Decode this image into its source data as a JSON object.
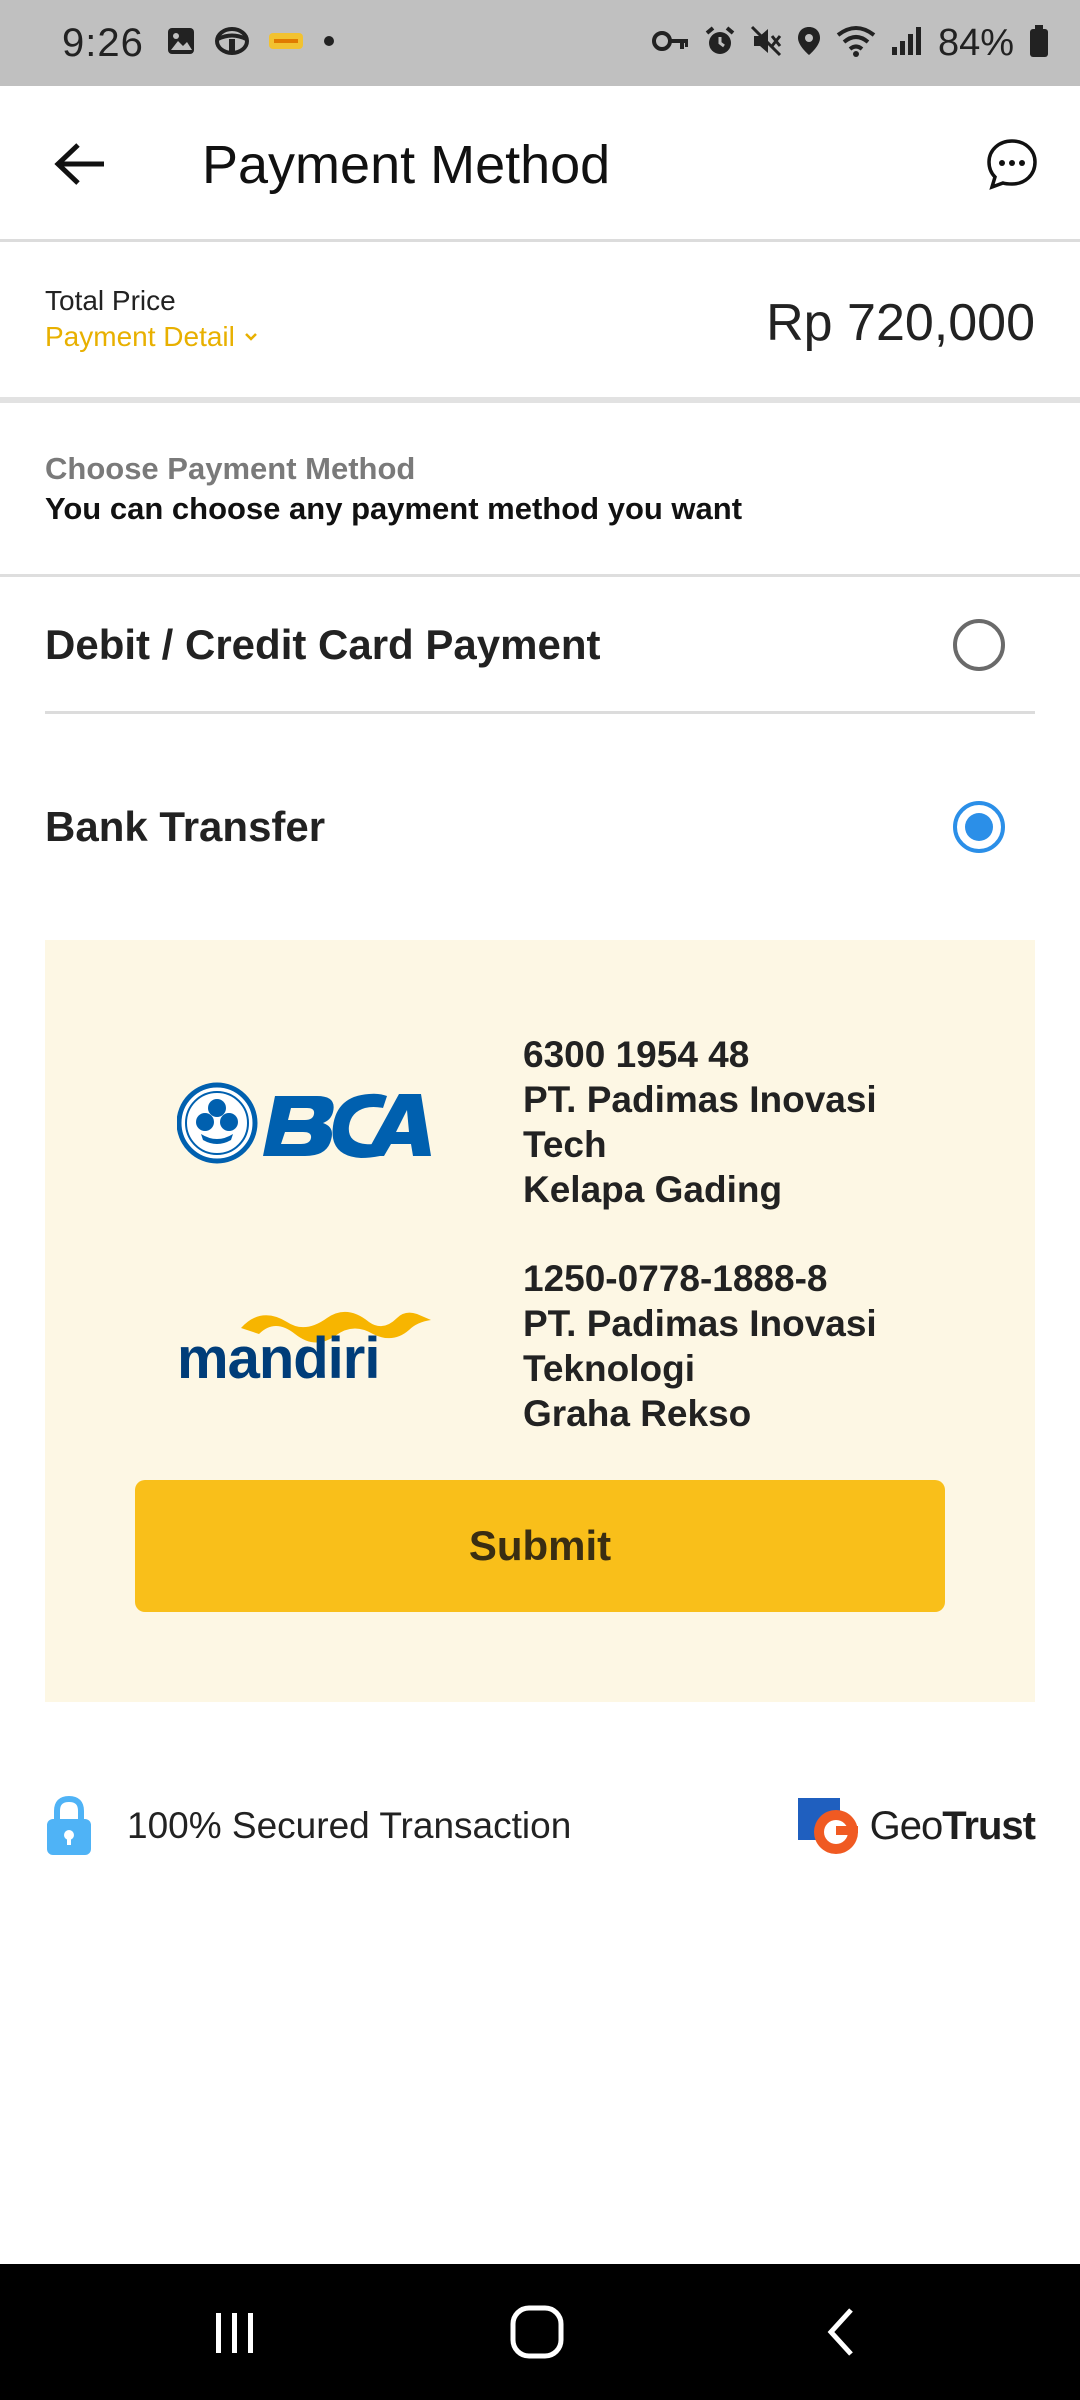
{
  "status_bar": {
    "time": "9:26",
    "battery_percent": "84%",
    "left_icons": [
      "image-icon",
      "steering-wheel-icon",
      "app-badge-icon",
      "dot-icon"
    ],
    "right_icons": [
      "key-icon",
      "alarm-icon",
      "mute-icon",
      "location-icon",
      "wifi-icon",
      "signal-icon",
      "battery-icon"
    ]
  },
  "app_bar": {
    "title": "Payment Method",
    "back_icon": "arrow-left-icon",
    "chat_icon": "chat-bubble-icon"
  },
  "total": {
    "label": "Total Price",
    "detail_link": "Payment Detail",
    "amount": "Rp 720,000"
  },
  "choose": {
    "title": "Choose Payment Method",
    "subtitle": "You can choose any payment method you want"
  },
  "options": [
    {
      "label": "Debit / Credit Card Payment",
      "selected": false
    },
    {
      "label": "Bank Transfer",
      "selected": true
    }
  ],
  "banks": [
    {
      "name": "BCA",
      "account_number": "6300 1954 48",
      "line1": "PT. Padimas Inovasi",
      "line2": "Tech",
      "line3": "Kelapa Gading"
    },
    {
      "name": "mandiri",
      "account_number": "1250-0778-1888-8",
      "line1": "PT. Padimas Inovasi",
      "line2": "Teknologi",
      "line3": "Graha Rekso"
    }
  ],
  "submit_label": "Submit",
  "security": {
    "text": "100% Secured Transaction",
    "badge_geo": "Geo",
    "badge_trust": "Trust"
  },
  "colors": {
    "accent_yellow": "#f9bf1a",
    "link_yellow": "#e8b000",
    "radio_blue": "#2b8fe8",
    "panel_bg": "#fdf7e4",
    "bca_blue": "#0060af",
    "mandiri_navy": "#003d79",
    "mandiri_gold": "#f7b500",
    "lock_blue": "#4fb3f6"
  }
}
